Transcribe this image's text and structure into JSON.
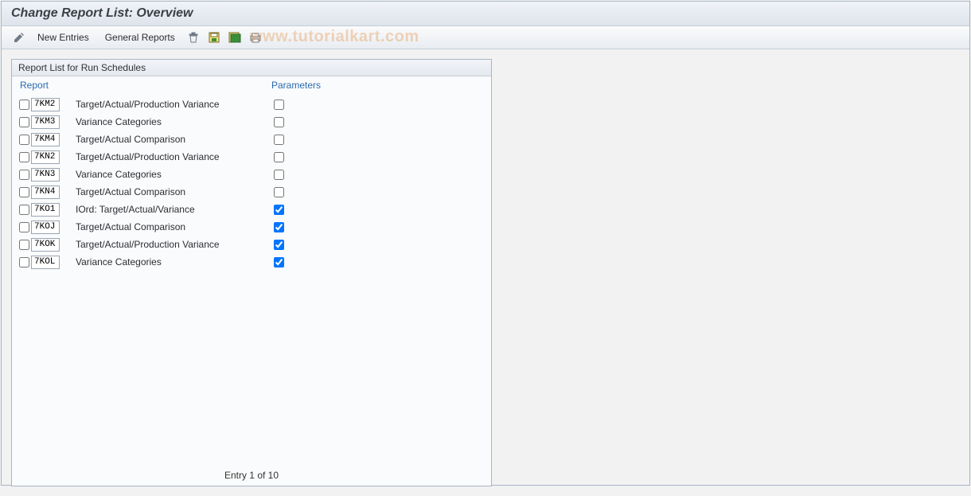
{
  "titlebar": {
    "title": "Change Report List: Overview"
  },
  "toolbar": {
    "pencil_title": "Change",
    "new_entries": "New Entries",
    "general_reports": "General Reports",
    "delete_title": "Delete",
    "save_title": "Save",
    "select_all_title": "Select All",
    "print_title": "Print"
  },
  "watermark": "www.tutorialkart.com",
  "panel": {
    "title": "Report List for Run Schedules"
  },
  "columns": {
    "report": "Report",
    "parameters": "Parameters"
  },
  "rows": [
    {
      "code": "7KM2",
      "desc": "Target/Actual/Production Variance",
      "param_checked": false
    },
    {
      "code": "7KM3",
      "desc": "Variance Categories",
      "param_checked": false
    },
    {
      "code": "7KM4",
      "desc": "Target/Actual Comparison",
      "param_checked": false
    },
    {
      "code": "7KN2",
      "desc": "Target/Actual/Production Variance",
      "param_checked": false
    },
    {
      "code": "7KN3",
      "desc": "Variance Categories",
      "param_checked": false
    },
    {
      "code": "7KN4",
      "desc": "Target/Actual Comparison",
      "param_checked": false
    },
    {
      "code": "7KO1",
      "desc": "IOrd: Target/Actual/Variance",
      "param_checked": true
    },
    {
      "code": "7KOJ",
      "desc": "Target/Actual Comparison",
      "param_checked": true
    },
    {
      "code": "7KOK",
      "desc": "Target/Actual/Production Variance",
      "param_checked": true
    },
    {
      "code": "7KOL",
      "desc": "Variance Categories",
      "param_checked": true
    }
  ],
  "footer": {
    "entry_pos": "Entry 1 of 10"
  }
}
